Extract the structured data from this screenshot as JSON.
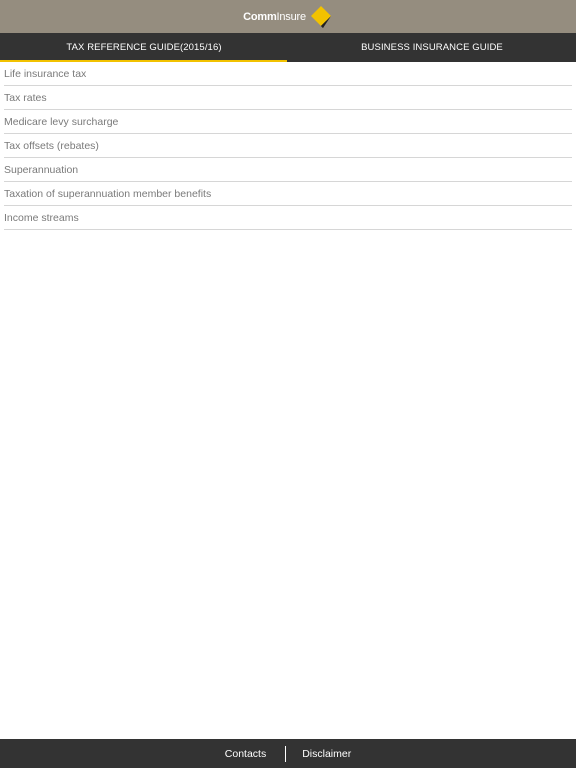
{
  "header": {
    "logo_text_bold": "Comm",
    "logo_text_light": "Insure",
    "logo_colors": {
      "yellow": "#f2c200",
      "black": "#222222"
    },
    "background": "#958d7f"
  },
  "tabs": [
    {
      "label": "TAX REFERENCE GUIDE(2015/16)",
      "active": true
    },
    {
      "label": "BUSINESS INSURANCE GUIDE",
      "active": false
    }
  ],
  "accent_color": "#f2c200",
  "list": {
    "items": [
      {
        "label": "Life insurance tax"
      },
      {
        "label": "Tax rates"
      },
      {
        "label": "Medicare levy surcharge"
      },
      {
        "label": "Tax offsets (rebates)"
      },
      {
        "label": "Superannuation"
      },
      {
        "label": "Taxation of superannuation member benefits"
      },
      {
        "label": "Income streams"
      }
    ]
  },
  "footer": {
    "contacts_label": "Contacts",
    "disclaimer_label": "Disclaimer"
  }
}
